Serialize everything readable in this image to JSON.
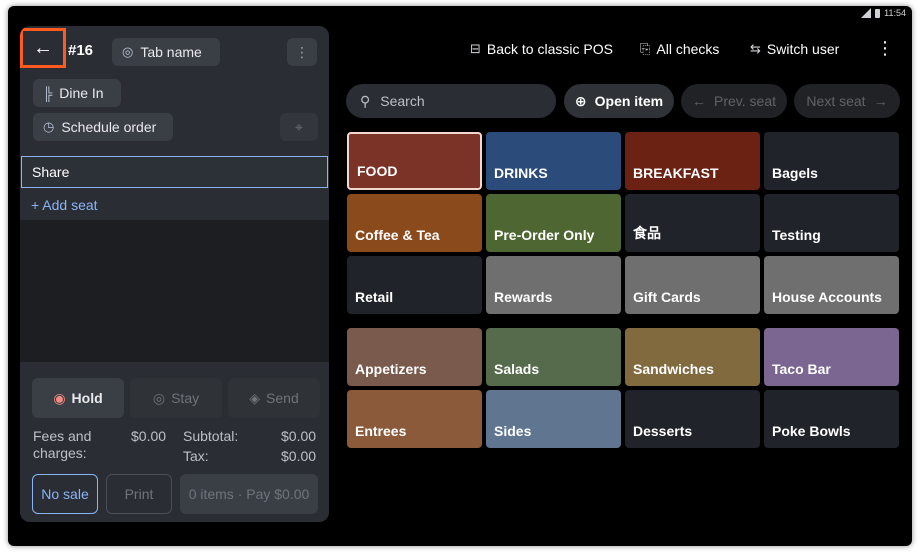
{
  "statusbar": {
    "time": "11:54"
  },
  "order": {
    "back_icon": "arrow-left-icon",
    "number": "#16",
    "tab_name": "Tab name",
    "dine_in": "Dine In",
    "schedule": "Schedule order"
  },
  "seats": {
    "share": "Share",
    "add_seat": "+ Add seat"
  },
  "footer": {
    "hold": "Hold",
    "stay": "Stay",
    "send": "Send",
    "fees_label": "Fees and charges:",
    "fees_value": "$0.00",
    "subtotal_label": "Subtotal:",
    "subtotal_value": "$0.00",
    "tax_label": "Tax:",
    "tax_value": "$0.00",
    "no_sale": "No sale",
    "print": "Print",
    "pay": "0 items · Pay $0.00"
  },
  "topbar": {
    "classic_pos": "Back to classic POS",
    "all_checks": "All checks",
    "switch_user": "Switch user"
  },
  "toolbar": {
    "search_placeholder": "Search",
    "open_item": "Open item",
    "prev_seat": "Prev. seat",
    "next_seat": "Next seat"
  },
  "categories": [
    {
      "label": "FOOD",
      "color": "#7a3326",
      "selected": true
    },
    {
      "label": "DRINKS",
      "color": "#2b4c7a"
    },
    {
      "label": "BREAKFAST",
      "color": "#6b2213"
    },
    {
      "label": "Bagels",
      "color": "#202329"
    },
    {
      "label": "Coffee & Tea",
      "color": "#8a4a1c"
    },
    {
      "label": "Pre-Order Only",
      "color": "#4e6632"
    },
    {
      "label": "食品",
      "color": "#202329"
    },
    {
      "label": "Testing",
      "color": "#202329"
    },
    {
      "label": "Retail",
      "color": "#202329"
    },
    {
      "label": "Rewards",
      "color": "#6f6f6f"
    },
    {
      "label": "Gift Cards",
      "color": "#6f6f6f"
    },
    {
      "label": "House Accounts",
      "color": "#6f6f6f"
    }
  ],
  "items": [
    {
      "label": "Appetizers",
      "color": "#7a5a4c"
    },
    {
      "label": "Salads",
      "color": "#566a4c"
    },
    {
      "label": "Sandwiches",
      "color": "#806a3e"
    },
    {
      "label": "Taco Bar",
      "color": "#7a6691"
    },
    {
      "label": "Entrees",
      "color": "#8a5a3a"
    },
    {
      "label": "Sides",
      "color": "#5f7590"
    },
    {
      "label": "Desserts",
      "color": "#202329"
    },
    {
      "label": "Poke Bowls",
      "color": "#202329"
    }
  ]
}
